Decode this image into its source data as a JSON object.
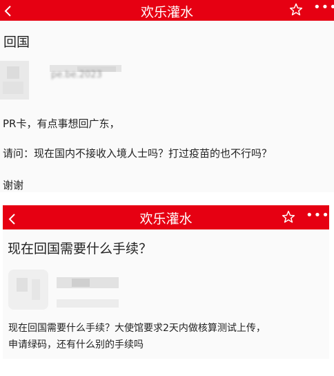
{
  "panel1": {
    "header": {
      "title": "欢乐灌水"
    },
    "post": {
      "title": "回国",
      "username_blurred": "pe.be.2023",
      "lines": [
        "PR卡，有点事想回广东，",
        "请问：现在国内不接收入境人士吗？打过疫苗的也不行吗？",
        "谢谢"
      ]
    }
  },
  "panel2": {
    "header": {
      "title": "欢乐灌水"
    },
    "post": {
      "title": "现在回国需要什么手续？",
      "body_lines": [
        "现在回国需要什么手续？大使馆要求2天内做核算测试上传，",
        "申请绿码，还有什么别的手续吗"
      ]
    }
  },
  "colors": {
    "header_bg": "#e60012",
    "header_text": "#ffffff",
    "panel_bg": "#fafafa"
  },
  "icons": {
    "back": "chevron-left-icon",
    "favorite": "star-outline-icon",
    "more": "more-dots-icon"
  }
}
